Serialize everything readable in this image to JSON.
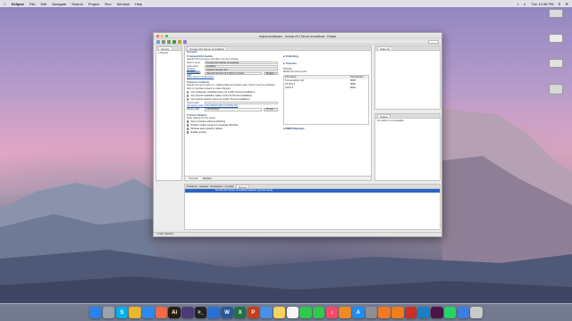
{
  "menubar": {
    "apple": "",
    "app_name": "Eclipse",
    "items": [
      "File",
      "Edit",
      "Navigate",
      "Search",
      "Project",
      "Run",
      "Window",
      "Help"
    ],
    "clock": "Thu 12:46 PM"
  },
  "window": {
    "title": "eclipse-workspace - Tomcat v9.0 Server at localhost - Eclipse",
    "servers_panel_tab": "Servers",
    "editor_tab": "Tomcat v9.0 Server at localhost",
    "outline_tab": "Task List",
    "outline2_tab": "Outline",
    "outline_text": "No outline is not available.",
    "editor_header": "Overview",
    "general": {
      "heading": "General Information",
      "desc": "Specify the host name and other common settings.",
      "server_name_label": "Server name:",
      "server_name_value": "Tomcat v9.0 Server at localhost",
      "host_name_label": "Host name:",
      "host_name_value": "localhost",
      "runtime_label": "Runtime Environment:",
      "runtime_value": "Apache Tomcat v9.0",
      "config_label": "Configuration path:",
      "config_value": "/Servers/Tomcat v9.0 Server at local",
      "browse": "Browse...",
      "open_launch": "Open launch configuration"
    },
    "locations": {
      "heading": "Server Locations",
      "desc": "Specify the server path (i.e. catalina.base) and deploy path. Server must be published with no modules present to make changes.",
      "opt1": "Use workspace metadata (does not modify Tomcat installation)",
      "opt2": "Use Tomcat installation (takes control of Tomcat installation)",
      "opt3": "Use custom location (does not modify Tomcat installation)",
      "server_path_label": "Server path:",
      "server_path_value": "",
      "set_deploy": "Set deploy path to the default value (currently set)",
      "deploy_path_label": "Deploy path:",
      "deploy_path_value": "wtpwebapps",
      "browse": "Browse..."
    },
    "options": {
      "heading": "Server Options",
      "desc": "Enter settings for the server.",
      "items": [
        {
          "label": "Serve modules without publishing",
          "checked": false
        },
        {
          "label": "Publish module contexts to separate XML files",
          "checked": false
        },
        {
          "label": "Modules auto reload by default",
          "checked": true
        },
        {
          "label": "Enable security",
          "checked": false
        }
      ]
    },
    "right_sections": {
      "publishing": "Publishing",
      "timeouts": "Timeouts",
      "ports_heading": "Ports",
      "ports_desc": "Modify the server ports.",
      "ports_col1": "Port Name",
      "ports_col2": "Port Number",
      "ports": [
        {
          "name": "Tomcat admin port",
          "num": "8005"
        },
        {
          "name": "HTTP/1.1",
          "num": "8080"
        },
        {
          "name": "AJP/1.3",
          "num": "8009"
        }
      ],
      "mime": "MIME Mappings"
    },
    "bottom_tabs": [
      "Overview",
      "Modules"
    ],
    "console_tabs": [
      "Problems",
      "Javadoc",
      "Declaration",
      "Console",
      "Servers"
    ],
    "console_row": "Tomcat v9.0 Server at localhost  [Started, Synchronized]",
    "status_text": "1 item selected"
  },
  "dock": {
    "icons": [
      "finder-icon",
      "launchpad-icon",
      "skype-icon",
      "chrome-icon",
      "safari-icon",
      "photos-icon",
      "illustrator-icon",
      "eclipse-icon",
      "terminal-icon",
      "xcode-icon",
      "word-icon",
      "excel-icon",
      "powerpoint-icon",
      "mail-icon",
      "notes-icon",
      "calendar-icon",
      "messages-icon",
      "facetime-icon",
      "music-icon",
      "books-icon",
      "appstore-icon",
      "preferences-icon",
      "sublime-icon",
      "vlc-icon",
      "filezilla-icon",
      "netbeans-icon",
      "slack-icon",
      "whatsapp-icon",
      "downloads-icon",
      "trash-icon"
    ],
    "letters": [
      "",
      "",
      "S",
      "",
      "",
      "",
      "Ai",
      "",
      ">_",
      "",
      "W",
      "X",
      "P",
      "",
      "",
      "",
      "",
      "",
      "♪",
      "",
      "A",
      "",
      "",
      "",
      "",
      "",
      "",
      "",
      "",
      ""
    ],
    "colors": [
      "#2a83e6",
      "#9aa3ad",
      "#00aff0",
      "#e9b630",
      "#2d8bf0",
      "#f06a4a",
      "#2b1d0e",
      "#4b3a78",
      "#222222",
      "#2a6fd6",
      "#2b579a",
      "#1e7145",
      "#c43e1c",
      "#4a90e2",
      "#f4d35e",
      "#f5f5f5",
      "#31c94b",
      "#31c94b",
      "#fa4a6a",
      "#f08a24",
      "#1e8ef0",
      "#8e8e93",
      "#f37a25",
      "#f07f1a",
      "#c9302c",
      "#1c7fbf",
      "#4a154b",
      "#25d366",
      "#3b7de0",
      "#c9c9c9"
    ]
  }
}
